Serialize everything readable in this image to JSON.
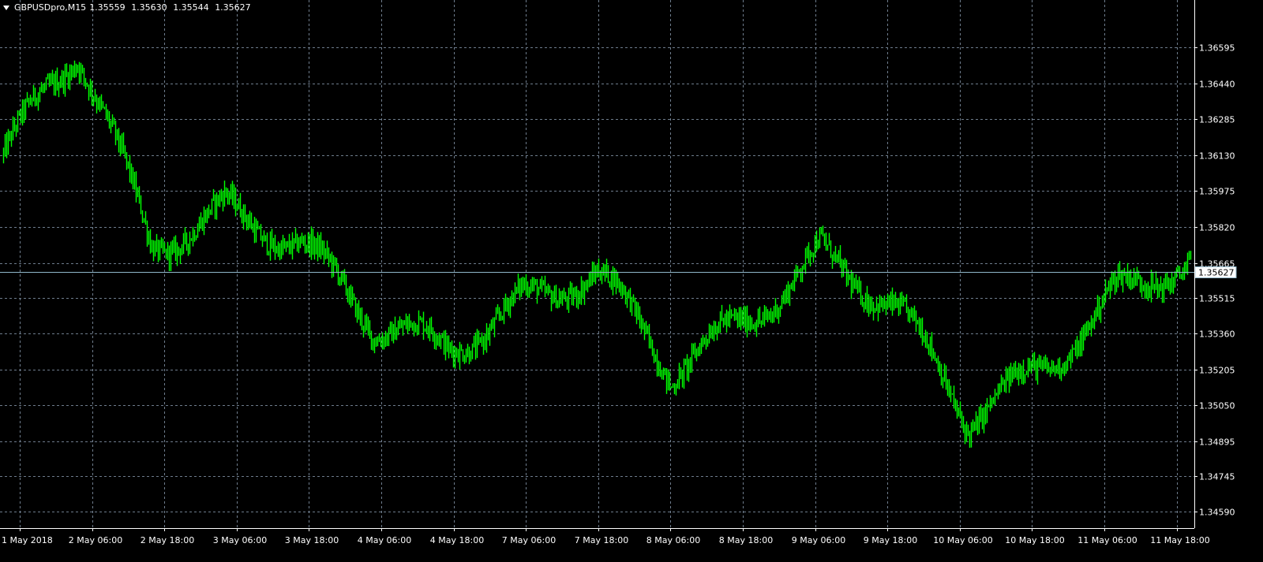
{
  "header": {
    "symbol_timeframe": "GBPUSDpro,M15",
    "open": "1.35559",
    "high": "1.35630",
    "low": "1.35544",
    "close": "1.35627"
  },
  "colors": {
    "background": "#000000",
    "grid": "#6e7c8c",
    "bars": "#00ff00",
    "axis_text": "#ffffff",
    "bid_line": "#8fb6c9"
  },
  "chart_data": {
    "type": "line",
    "title": "GBPUSDpro,M15",
    "xlabel": "",
    "ylabel": "",
    "ylim": [
      1.3452,
      1.368
    ],
    "grid": true,
    "y_ticks": [
      "1.36595",
      "1.36440",
      "1.36285",
      "1.36130",
      "1.35975",
      "1.35820",
      "1.35665",
      "1.35515",
      "1.35360",
      "1.35205",
      "1.35050",
      "1.34895",
      "1.34745",
      "1.34590"
    ],
    "x_ticks": [
      "1 May 2018",
      "2 May 06:00",
      "2 May 18:00",
      "3 May 06:00",
      "3 May 18:00",
      "4 May 06:00",
      "4 May 18:00",
      "7 May 06:00",
      "7 May 18:00",
      "8 May 06:00",
      "8 May 18:00",
      "9 May 06:00",
      "9 May 18:00",
      "10 May 06:00",
      "10 May 18:00",
      "11 May 06:00",
      "11 May 18:00"
    ],
    "current_price_label": "1.35627",
    "current_price": 1.35627,
    "series": [
      {
        "x": [
          "1 May 2018",
          "2 May 06:00",
          "2 May 18:00",
          "3 May 06:00",
          "3 May 18:00",
          "4 May 06:00",
          "4 May 18:00",
          "7 May 06:00",
          "7 May 18:00",
          "8 May 06:00",
          "8 May 18:00",
          "9 May 06:00",
          "9 May 18:00",
          "10 May 06:00",
          "10 May 18:00",
          "11 May 06:00",
          "11 May 18:00"
        ],
        "y": [
          1.3612,
          1.3649,
          1.3575,
          1.36,
          1.3573,
          1.353,
          1.3532,
          1.356,
          1.356,
          1.351,
          1.3545,
          1.358,
          1.3545,
          1.349,
          1.3525,
          1.3563,
          1.3563
        ]
      }
    ]
  }
}
